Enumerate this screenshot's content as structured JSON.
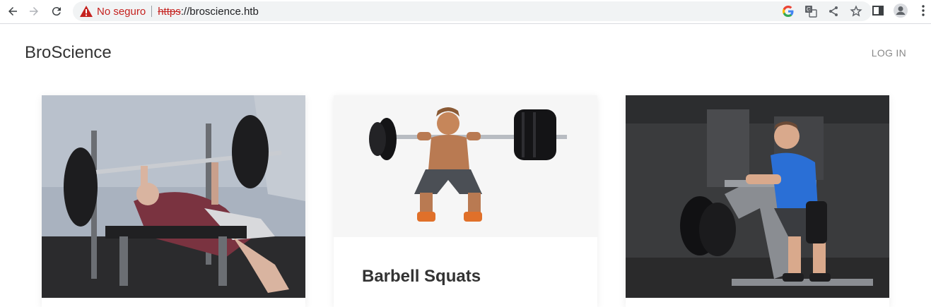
{
  "browser": {
    "security_label": "No seguro",
    "url_scheme": "https",
    "url_rest": "://broscience.htb"
  },
  "site": {
    "brand": "BroScience",
    "login_label": "LOG IN"
  },
  "cards": [
    {
      "image": "bench-press-photo",
      "title": ""
    },
    {
      "image": "barbell-squat-photo",
      "title": "Barbell Squats"
    },
    {
      "image": "seated-row-machine-photo",
      "title": ""
    }
  ],
  "colors": {
    "warning": "#c5221f",
    "text": "#333333",
    "muted": "#888888"
  }
}
